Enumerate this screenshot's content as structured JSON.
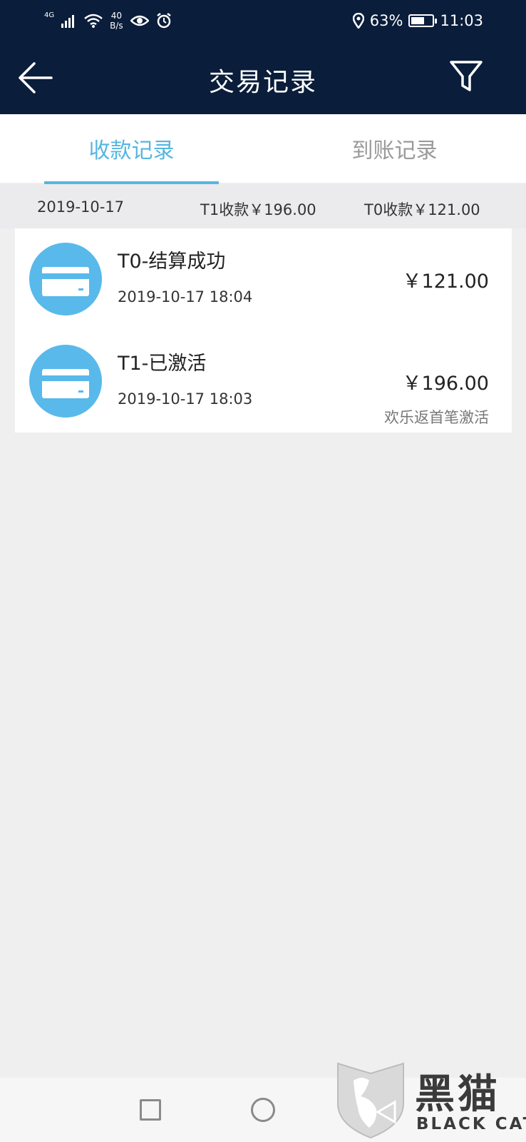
{
  "status_bar": {
    "network": "4G",
    "speed_value": "40",
    "speed_unit": "B/s",
    "battery_percent": "63%",
    "battery_level": 0.63,
    "time": "11:03"
  },
  "header": {
    "title": "交易记录",
    "back_icon": "arrow-left-icon",
    "filter_icon": "funnel-icon"
  },
  "tabs": [
    {
      "label": "收款记录",
      "active": true
    },
    {
      "label": "到账记录",
      "active": false
    }
  ],
  "summary": {
    "date": "2019-10-17",
    "t1_total": "T1收款￥196.00",
    "t0_total": "T0收款￥121.00"
  },
  "records": [
    {
      "title": "T0-结算成功",
      "time": "2019-10-17 18:04",
      "amount": "￥121.00",
      "note": ""
    },
    {
      "title": "T1-已激活",
      "time": "2019-10-17 18:03",
      "amount": "￥196.00",
      "note": "欢乐返首笔激活"
    }
  ],
  "watermark": {
    "brand": "黑猫",
    "sub": "BLACK CAT"
  },
  "colors": {
    "header_bg": "#0a1d3a",
    "accent": "#56b6e0",
    "icon_bg": "#59b9ea",
    "page_bg": "#efeff0"
  }
}
